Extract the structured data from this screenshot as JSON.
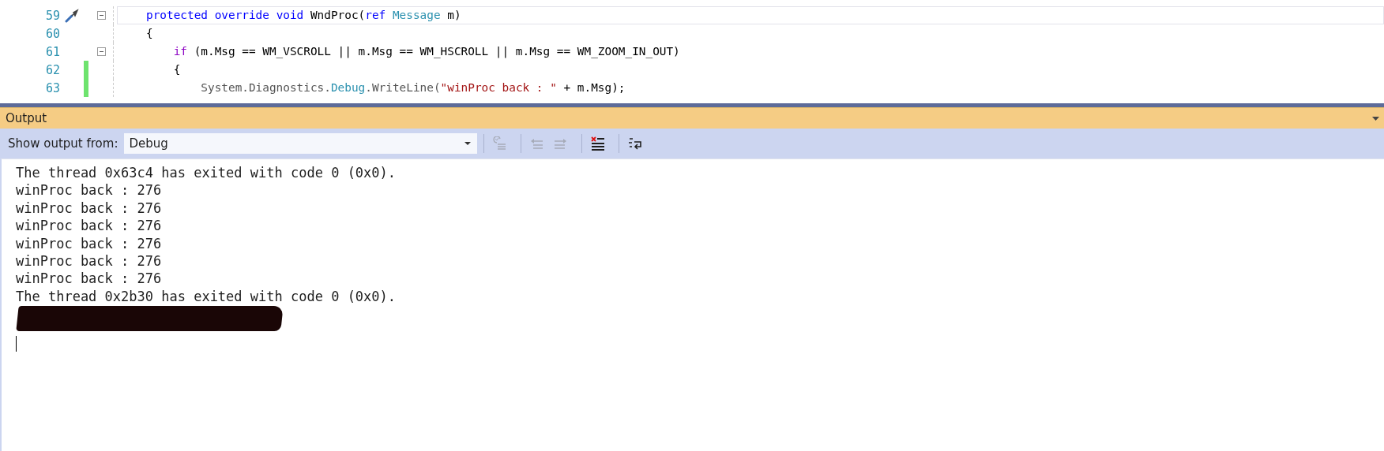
{
  "code_editor": {
    "lines": [
      {
        "number": "59",
        "current": true,
        "fold": true,
        "changed": false,
        "quick_action": true,
        "tokens": [
          {
            "text": "protected ",
            "kind": "keyword"
          },
          {
            "text": "override ",
            "kind": "keyword"
          },
          {
            "text": "void",
            "kind": "keyword"
          },
          {
            "text": " WndProc(",
            "kind": "plain"
          },
          {
            "text": "ref ",
            "kind": "keyword"
          },
          {
            "text": "Message",
            "kind": "type"
          },
          {
            "text": " m)",
            "kind": "plain"
          }
        ]
      },
      {
        "number": "60",
        "current": false,
        "fold": false,
        "changed": false,
        "quick_action": false,
        "tokens": [
          {
            "text": "{",
            "kind": "plain"
          }
        ]
      },
      {
        "number": "61",
        "current": false,
        "fold": true,
        "changed": false,
        "quick_action": false,
        "tokens": [
          {
            "text": "    if",
            "kind": "control"
          },
          {
            "text": " (m.Msg == WM_VSCROLL || m.Msg == WM_HSCROLL || m.Msg == WM_ZOOM_IN_OUT)",
            "kind": "plain"
          }
        ]
      },
      {
        "number": "62",
        "current": false,
        "fold": false,
        "changed": true,
        "quick_action": false,
        "tokens": [
          {
            "text": "    {",
            "kind": "plain"
          }
        ]
      },
      {
        "number": "63",
        "current": false,
        "fold": false,
        "changed": true,
        "quick_action": false,
        "tokens": [
          {
            "text": "        System.Diagnostics.",
            "kind": "member"
          },
          {
            "text": "Debug",
            "kind": "type"
          },
          {
            "text": ".WriteLine(",
            "kind": "member"
          },
          {
            "text": "\"winProc back : \"",
            "kind": "string"
          },
          {
            "text": " + m.Msg);",
            "kind": "plain"
          }
        ]
      }
    ]
  },
  "output": {
    "title": "Output",
    "toolbar": {
      "label": "Show output from:",
      "source": "Debug",
      "buttons": [
        {
          "kind": "find-source",
          "disabled": true
        },
        {
          "kind": "previous",
          "disabled": true
        },
        {
          "kind": "next",
          "disabled": true
        },
        {
          "kind": "clear",
          "disabled": false
        },
        {
          "kind": "word-wrap",
          "disabled": false
        }
      ]
    },
    "lines": [
      {
        "kind": "text",
        "text": "The thread 0x63c4 has exited with code 0 (0x0)."
      },
      {
        "kind": "text",
        "text": "winProc back : 276"
      },
      {
        "kind": "text",
        "text": "winProc back : 276"
      },
      {
        "kind": "text",
        "text": "winProc back : 276"
      },
      {
        "kind": "text",
        "text": "winProc back : 276"
      },
      {
        "kind": "text",
        "text": "winProc back : 276"
      },
      {
        "kind": "text",
        "text": "winProc back : 276"
      },
      {
        "kind": "text",
        "text": "The thread 0x2b30 has exited with code 0 (0x0)."
      },
      {
        "kind": "redacted"
      },
      {
        "kind": "caret"
      }
    ]
  }
}
